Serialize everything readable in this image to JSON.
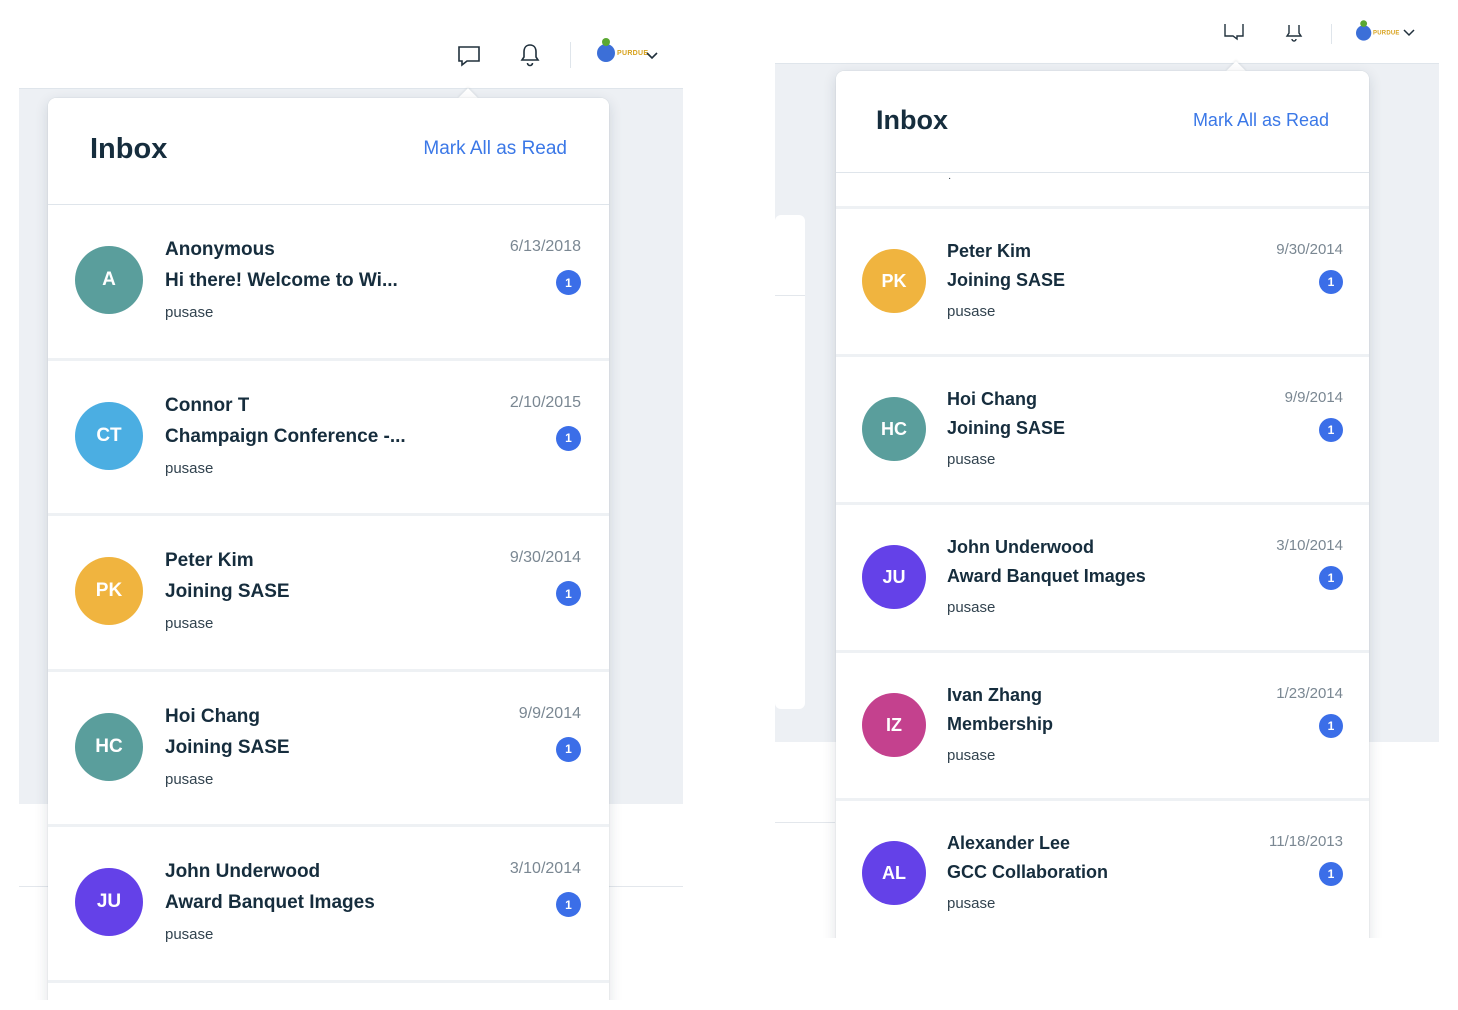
{
  "colors": {
    "accent": "#3b78e7",
    "badge": "#3b6ee8",
    "avatar_teal": "#5a9e9c",
    "avatar_blue": "#4baee2",
    "avatar_yellow": "#f0b43f",
    "avatar_purple": "#6441e8",
    "avatar_magenta": "#c4418e"
  },
  "topbar": {
    "icons": [
      "chat-icon",
      "bell-icon",
      "site-logo",
      "chevron-down-icon"
    ],
    "logo_text": "PURDUE"
  },
  "left": {
    "inbox": {
      "title": "Inbox",
      "mark_all_read": "Mark All as Read",
      "messages": [
        {
          "initials": "A",
          "sender": "Anonymous",
          "subject": "Hi there! Welcome to Wi...",
          "site": "pusase",
          "date": "6/13/2018",
          "unread": "1",
          "color": "#5a9e9c"
        },
        {
          "initials": "CT",
          "sender": "Connor T",
          "subject": "Champaign Conference -...",
          "site": "pusase",
          "date": "2/10/2015",
          "unread": "1",
          "color": "#4baee2"
        },
        {
          "initials": "PK",
          "sender": "Peter Kim",
          "subject": "Joining SASE",
          "site": "pusase",
          "date": "9/30/2014",
          "unread": "1",
          "color": "#f0b43f"
        },
        {
          "initials": "HC",
          "sender": "Hoi Chang",
          "subject": "Joining SASE",
          "site": "pusase",
          "date": "9/9/2014",
          "unread": "1",
          "color": "#5a9e9c"
        },
        {
          "initials": "JU",
          "sender": "John Underwood",
          "subject": "Award Banquet Images",
          "site": "pusase",
          "date": "3/10/2014",
          "unread": "1",
          "color": "#6441e8"
        }
      ]
    }
  },
  "right": {
    "inbox": {
      "title": "Inbox",
      "mark_all_read": "Mark All as Read",
      "partial_text": "·",
      "messages": [
        {
          "initials": "PK",
          "sender": "Peter Kim",
          "subject": "Joining SASE",
          "site": "pusase",
          "date": "9/30/2014",
          "unread": "1",
          "color": "#f0b43f"
        },
        {
          "initials": "HC",
          "sender": "Hoi Chang",
          "subject": "Joining SASE",
          "site": "pusase",
          "date": "9/9/2014",
          "unread": "1",
          "color": "#5a9e9c"
        },
        {
          "initials": "JU",
          "sender": "John Underwood",
          "subject": "Award Banquet Images",
          "site": "pusase",
          "date": "3/10/2014",
          "unread": "1",
          "color": "#6441e8"
        },
        {
          "initials": "IZ",
          "sender": "Ivan Zhang",
          "subject": "Membership",
          "site": "pusase",
          "date": "1/23/2014",
          "unread": "1",
          "color": "#c4418e"
        },
        {
          "initials": "AL",
          "sender": "Alexander Lee",
          "subject": "GCC Collaboration",
          "site": "pusase",
          "date": "11/18/2013",
          "unread": "1",
          "color": "#6441e8"
        }
      ]
    }
  }
}
